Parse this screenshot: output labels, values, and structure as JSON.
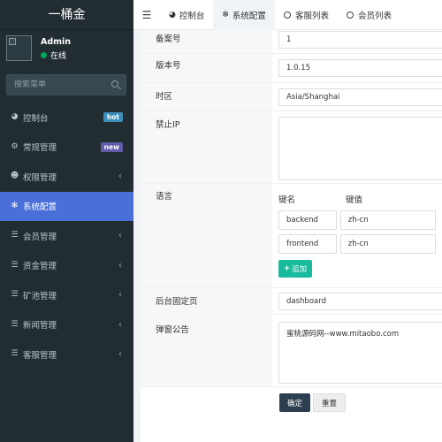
{
  "brand": {
    "title": "一桶金"
  },
  "user": {
    "name": "Admin",
    "status": "在线"
  },
  "search": {
    "placeholder": "搜索菜单"
  },
  "sidebar": {
    "items": [
      {
        "label": "控制台",
        "icon": "dashboard-icon",
        "badge": "hot"
      },
      {
        "label": "常规管理",
        "icon": "cogs-icon",
        "badge": "new"
      },
      {
        "label": "权限管理",
        "icon": "users-icon"
      },
      {
        "label": "系统配置",
        "icon": "cog-icon",
        "active": true
      },
      {
        "label": "会员管理",
        "icon": "list-icon"
      },
      {
        "label": "资金管理",
        "icon": "list-icon"
      },
      {
        "label": "矿池管理",
        "icon": "list-icon"
      },
      {
        "label": "新闻管理",
        "icon": "list-icon"
      },
      {
        "label": "客服管理",
        "icon": "list-icon"
      }
    ]
  },
  "tabs": [
    {
      "label": "控制台",
      "icon": "dashboard-icon"
    },
    {
      "label": "系统配置",
      "icon": "cog-icon",
      "active": true
    },
    {
      "label": "客服列表",
      "icon": "circle-icon"
    },
    {
      "label": "会员列表",
      "icon": "circle-icon"
    }
  ],
  "form": {
    "record_no": {
      "label": "备案号",
      "value": "1"
    },
    "version": {
      "label": "版本号",
      "value": "1.0.15"
    },
    "timezone": {
      "label": "时区",
      "value": "Asia/Shanghai"
    },
    "forbidden_ip": {
      "label": "禁止IP",
      "value": ""
    },
    "language": {
      "label": "语言",
      "key_header": "键名",
      "value_header": "键值",
      "rows": [
        {
          "key": "backend",
          "value": "zh-cn"
        },
        {
          "key": "frontend",
          "value": "zh-cn"
        }
      ],
      "add_label": "追加"
    },
    "fixed_page": {
      "label": "后台固定页",
      "value": "dashboard"
    },
    "popup": {
      "label": "弹窗公告",
      "value": "蜜桃源码网--www.mitaobo.com"
    },
    "submit_label": "确定",
    "reset_label": "重置"
  }
}
